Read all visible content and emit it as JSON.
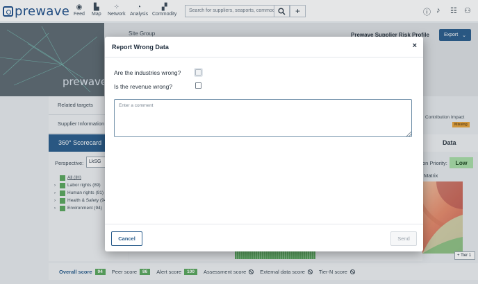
{
  "header": {
    "logo_text": "prewave",
    "nav": [
      {
        "label": "Feed",
        "icon": "feed-icon"
      },
      {
        "label": "Map",
        "icon": "map-icon"
      },
      {
        "label": "Network",
        "icon": "network-icon"
      },
      {
        "label": "Analysis",
        "icon": "analysis-icon"
      },
      {
        "label": "Commodity",
        "icon": "commodity-icon"
      }
    ],
    "search_placeholder": "Search for suppliers, seaports, commodities",
    "right_icons": [
      "help-icon",
      "bell-icon",
      "checklist-icon",
      "user-menu-icon"
    ]
  },
  "page": {
    "banner_logo": "prewave",
    "site_group": "Site Group",
    "profile_tag": "Prewave Supplier Risk Profile",
    "export_label": "Export",
    "left_tabs": [
      "Related targets",
      "Supplier Information"
    ],
    "scorecard_title": "360° Scorecard",
    "perspective_label": "Perspective:",
    "perspective_value": "LkSG",
    "tree": [
      {
        "label": "All (IH)",
        "expandable": false
      },
      {
        "label": "Labor rights (89)",
        "expandable": true
      },
      {
        "label": "Human rights (91)",
        "expandable": true
      },
      {
        "label": "Health & Safety (94",
        "expandable": true
      },
      {
        "label": "Environment (94)",
        "expandable": true
      }
    ],
    "contrib_label": "Contribution  Impact",
    "missing_label": "Missing",
    "data_title": "Data",
    "priority_label": "on Priority:",
    "priority_value": "Low",
    "matrix_label": "Matrix",
    "tier_label": "Tier 1",
    "scores": [
      {
        "label": "Overall score",
        "value": "94"
      },
      {
        "label": "Peer score",
        "value": "86"
      },
      {
        "label": "Alert score",
        "value": "100"
      },
      {
        "label": "Assessment score",
        "value": null
      },
      {
        "label": "External data score",
        "value": null
      },
      {
        "label": "Tier-N score",
        "value": null
      }
    ],
    "colors": {
      "brand": "#2a5d8c",
      "score_green": "#5aa85e",
      "missing_orange": "#e8a33a",
      "low_green": "#a9dea8"
    }
  },
  "modal": {
    "title": "Report Wrong Data",
    "close_symbol": "×",
    "question_1": "Are the industries wrong?",
    "question_2": "Is the revenue wrong?",
    "comment_placeholder": "Enter a comment",
    "cancel_label": "Cancel",
    "send_label": "Send"
  }
}
